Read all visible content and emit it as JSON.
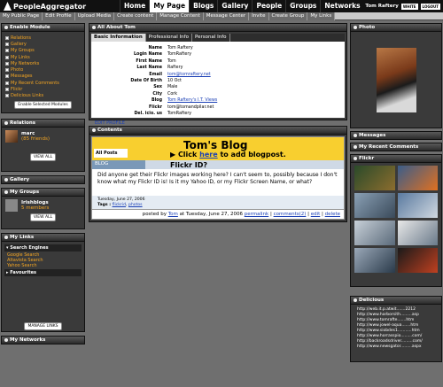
{
  "app": {
    "logo": "PeopleAggregator",
    "user": "Tom Raftery",
    "white_btn": "WHITE",
    "logout_btn": "LOGOUT"
  },
  "nav": [
    "Home",
    "My Page",
    "Blogs",
    "Gallery",
    "People",
    "Groups",
    "Networks"
  ],
  "subnav": [
    "My Public Page",
    "Edit Profile",
    "Upload Media",
    "Create content",
    "Manage Content",
    "Message Center",
    "Invite",
    "Create Group",
    "My Links"
  ],
  "left": {
    "enable_module": {
      "title": "Enable Module",
      "items": [
        "Relations",
        "Gallery",
        "My Groups",
        "My Links",
        "My Networks",
        "Photo",
        "Messages",
        "My Recent Comments",
        "Flickr",
        "Delicious Links"
      ],
      "button": "Enable Selected Modules"
    },
    "relations": {
      "title": "Relations",
      "name": "marc",
      "count": "(85 friends)",
      "button": "VIEW ALL"
    },
    "gallery": {
      "title": "Gallery"
    },
    "my_groups": {
      "title": "My Groups",
      "name": "Irishblogs",
      "count": "5 members",
      "button": "VIEW ALL"
    },
    "my_links": {
      "title": "My Links",
      "cat1": "Search Engines",
      "links": [
        "Google Search",
        "Altavista Search",
        "Yahoo Search"
      ],
      "cat2": "Favourites",
      "button": "MANAGE LINKS"
    },
    "my_networks": {
      "title": "My Networks"
    }
  },
  "about": {
    "title": "All About Tom",
    "tabs": [
      "Basic Information",
      "Professional Info",
      "Personal Info"
    ],
    "rows": [
      [
        "Name",
        "Tom Raftery"
      ],
      [
        "Login Name",
        "TomRaftery"
      ],
      [
        "First Name",
        "Tom"
      ],
      [
        "Last Name",
        "Raftery"
      ],
      [
        "Email",
        "tom@tomraftery.net"
      ],
      [
        "Date Of Birth",
        "10 Oct"
      ],
      [
        "Sex",
        "Male"
      ],
      [
        "City",
        "Cork"
      ],
      [
        "Blog",
        "Tom Raftery's I.T. Views"
      ],
      [
        "Flickr",
        "tom@tomandpilar.net"
      ],
      [
        "Del. icio. us",
        "TomRaftery"
      ]
    ],
    "edit": "EDIT PROFILE"
  },
  "contents": {
    "title": "Contents",
    "blog_title": "Tom's Blog",
    "click": "Click",
    "here": "here",
    "to_add": "to add blogpost.",
    "all_posts": "All Posts",
    "blog_tab": "BLOG",
    "post_title": "Flickr ID?",
    "post_body": "Did anyone get their Flickr images working here? I can't seem to, possibly because I don't know what my Flickr ID is! Is it my Yahoo ID, or my Flickr Screen Name, or what?",
    "date": "Tuesday, June 27, 2006",
    "tags_label": "Tags :",
    "tag1": "flickrid",
    "tag2": "photos",
    "posted_by": "posted by",
    "author": "Tom",
    "at": "at Tuesday, June 27, 2006",
    "permalink": "permalink",
    "comments": "comments(2)",
    "edit": "edit",
    "delete": "delete"
  },
  "right": {
    "photo": "Photo",
    "messages": "Messages",
    "recent_comments": "My Recent Comments",
    "flickr": "Flickr",
    "delicious": "Delicious",
    "del_links": [
      "http://web.it.p.atwit.......2212",
      "http://www.harborsith.........asp",
      "http://www.tomrafte.......htm",
      "http://www.jowel-aqua.......htm",
      "http://www.siobdes1...........htm",
      "http://www.horrasspio.........com/",
      "http://backroadsdriver.........com/",
      "http://www.newsgator.........aspx"
    ]
  }
}
